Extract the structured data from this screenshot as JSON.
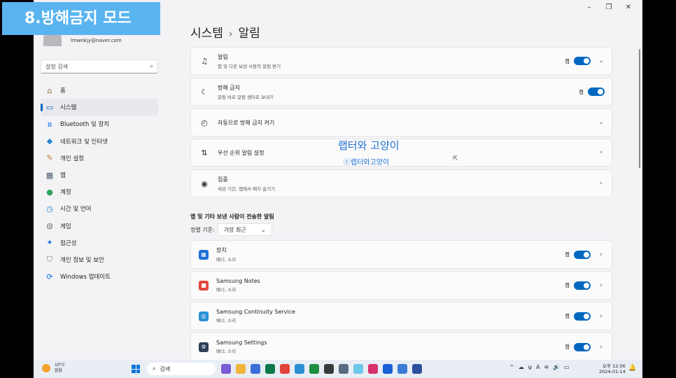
{
  "banner": "8.방해금지 모드",
  "window_controls": [
    "–",
    "❐",
    "✕"
  ],
  "account": {
    "email": "lmwnkjy@naver.com"
  },
  "search": {
    "placeholder": "설정 검색",
    "icon": "search-icon"
  },
  "sidebar": {
    "items": [
      {
        "label": "홈",
        "icon": "home-icon",
        "color": "#8a6d3b"
      },
      {
        "label": "시스템",
        "icon": "monitor-icon",
        "color": "#0067c0",
        "active": true
      },
      {
        "label": "Bluetooth 및 장치",
        "icon": "bluetooth-icon",
        "color": "#1a73e8"
      },
      {
        "label": "네트워크 및 인터넷",
        "icon": "wifi-icon",
        "color": "#2a86d3"
      },
      {
        "label": "개인 설정",
        "icon": "brush-icon",
        "color": "#c17a2a"
      },
      {
        "label": "앱",
        "icon": "apps-icon",
        "color": "#4a5a70"
      },
      {
        "label": "계정",
        "icon": "person-icon",
        "color": "#2fa35a"
      },
      {
        "label": "시간 및 언어",
        "icon": "globe-clock-icon",
        "color": "#2a86d3"
      },
      {
        "label": "게임",
        "icon": "gamepad-icon",
        "color": "#777777"
      },
      {
        "label": "접근성",
        "icon": "accessibility-icon",
        "color": "#1a73e8"
      },
      {
        "label": "개인 정보 및 보안",
        "icon": "shield-icon",
        "color": "#777777"
      },
      {
        "label": "Windows 업데이트",
        "icon": "update-icon",
        "color": "#0a74da"
      }
    ]
  },
  "breadcrumb": {
    "parent": "시스템",
    "separator": "›",
    "current": "알림"
  },
  "settings": [
    {
      "title": "알림",
      "subtitle": "앱 및 다른 보낸 사람의 알림 받기",
      "icon": "bell-icon",
      "toggle_label": "켬",
      "toggle": true,
      "chevron": "⌄"
    },
    {
      "title": "방해 금지",
      "subtitle": "알림 바로 알림 센터로 보내기",
      "icon": "bell-dnd-icon",
      "toggle_label": "켬",
      "toggle": true,
      "chevron": ""
    },
    {
      "title": "자동으로 방해 금지 켜기",
      "subtitle": "",
      "icon": "clock-icon",
      "toggle_label": "",
      "toggle": false,
      "chevron": "⌄"
    },
    {
      "title": "우선 순위 알림 설정",
      "subtitle": "",
      "icon": "priority-sort-icon",
      "toggle_label": "",
      "toggle": false,
      "chevron": "›"
    },
    {
      "title": "집중",
      "subtitle": "세션 기간, 앱에서 배지 숨기기",
      "icon": "focus-icon",
      "toggle_label": "",
      "toggle": false,
      "chevron": "›"
    }
  ],
  "section_title": "앱 및 기타 보낸 사람이 전송한 알림",
  "sort": {
    "label": "정렬 기준:",
    "value": "가장 최근"
  },
  "apps": [
    {
      "title": "장치",
      "subtitle": "배너, 소리",
      "icon": "devices-app-icon",
      "color": "#1a6fd6",
      "toggle_label": "켬",
      "toggle": true
    },
    {
      "title": "Samsung Notes",
      "subtitle": "배너, 소리",
      "icon": "samsung-notes-icon",
      "color": "#e0433b",
      "toggle_label": "켬",
      "toggle": true
    },
    {
      "title": "Samsung Continuity Service",
      "subtitle": "배너, 소리",
      "icon": "samsung-continuity-icon",
      "color": "#2b8fd6",
      "toggle_label": "켬",
      "toggle": true
    },
    {
      "title": "Samsung Settings",
      "subtitle": "배너, 소리",
      "icon": "samsung-settings-icon",
      "color": "#2d3e57",
      "toggle_label": "켬",
      "toggle": true
    }
  ],
  "watermark": {
    "line1": "랩터와 고양이",
    "line2": "ⓒ랩터와고양이"
  },
  "taskbar": {
    "weather_temp": "10°C",
    "weather_text": "맑음",
    "search_label": "검색",
    "app_colors": [
      "#7b5cd6",
      "#f1b53c",
      "#3a6fd8",
      "#0a7a4a",
      "#e0433b",
      "#2b8fd6",
      "#1e8f3e",
      "#3a3a3a",
      "#5a6a80",
      "#6dc7e8",
      "#d6336c",
      "#1a5fd6",
      "#3a7bd8",
      "#2c4f9e"
    ],
    "tray_icons": [
      "^",
      "☁",
      "ψ",
      "A",
      "≋",
      "🔊",
      "▭"
    ],
    "time": "오후 12:56",
    "date": "2024-01-14"
  }
}
